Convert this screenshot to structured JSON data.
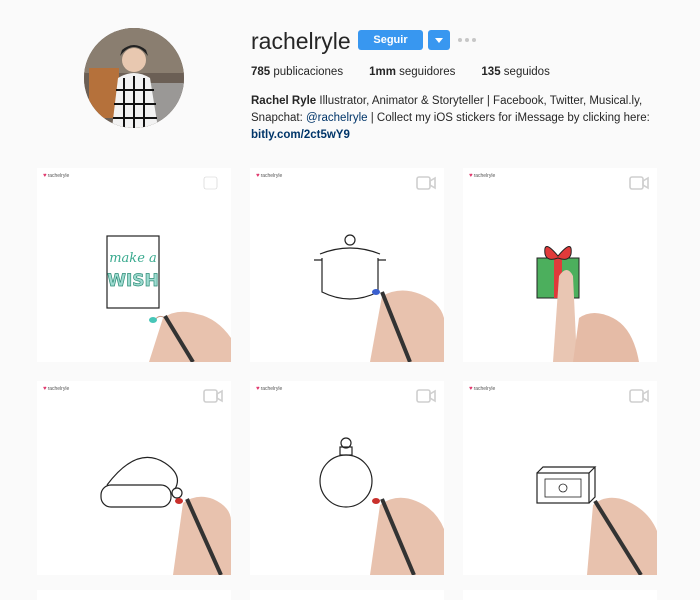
{
  "profile": {
    "username": "rachelryle",
    "follow_label": "Seguir",
    "stats": {
      "posts_count": "785",
      "posts_label": "publicaciones",
      "followers_count": "1mm",
      "followers_label": "seguidores",
      "following_count": "135",
      "following_label": "seguidos"
    },
    "bio": {
      "name": "Rachel Ryle",
      "line1": "Illustrator, Animator & Storyteller | Facebook, Twitter, Musical.ly,",
      "line2_prefix": "Snapchat:",
      "mention": "@rachelryle",
      "line2_suffix": "| Collect my iOS stickers for iMessage by clicking here:",
      "link": "bitly.com/2ct5wY9"
    }
  },
  "posts": [
    {
      "logo": "rachelryle",
      "icon": "video-icon"
    },
    {
      "logo": "rachelryle",
      "icon": "video-icon"
    },
    {
      "logo": "rachelryle",
      "icon": "video-icon"
    },
    {
      "logo": "rachelryle",
      "icon": "video-icon"
    },
    {
      "logo": "rachelryle",
      "icon": "video-icon"
    },
    {
      "logo": "rachelryle",
      "icon": "video-icon"
    }
  ],
  "post_art": {
    "card_text_line1": "make a",
    "card_text_line2": "WISH"
  },
  "colors": {
    "accent": "#3897f0",
    "link": "#003569",
    "background": "#fafafa"
  }
}
